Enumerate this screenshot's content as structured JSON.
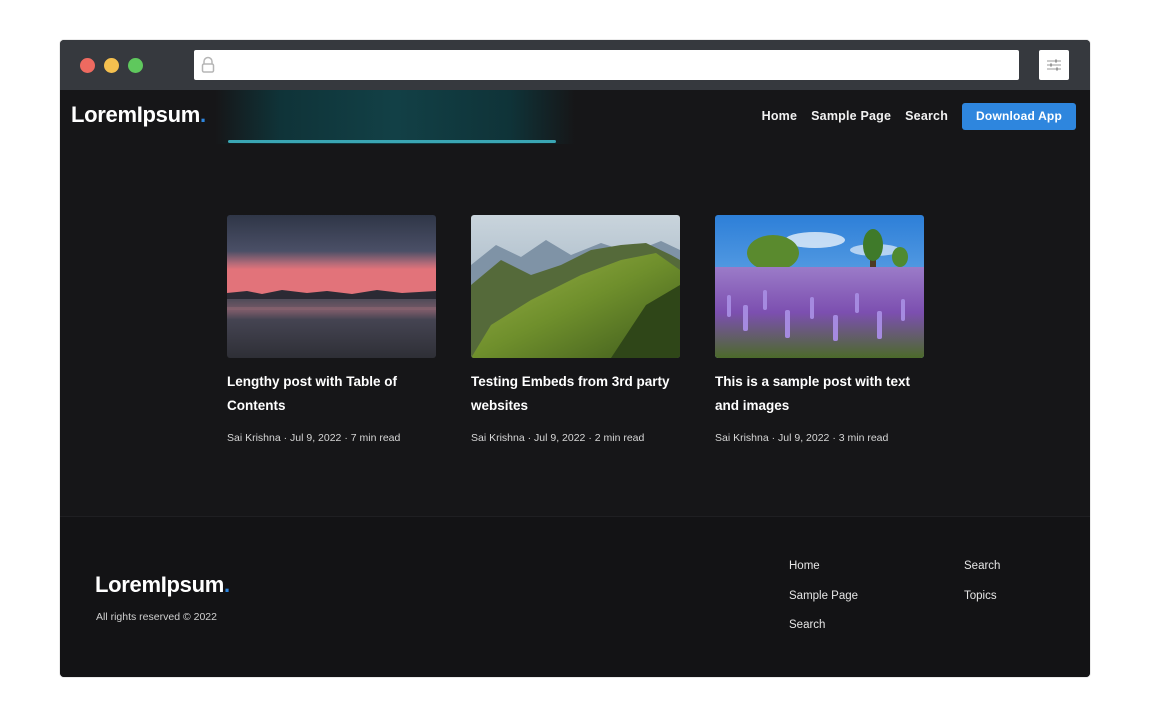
{
  "site": {
    "logo_text": "LoremIpsum",
    "logo_dot": "."
  },
  "nav": {
    "items": [
      "Home",
      "Sample Page",
      "Search"
    ],
    "cta_label": "Download App"
  },
  "posts": [
    {
      "title": "Lengthy post with Table of Contents",
      "meta": "Sai Krishna · Jul 9, 2022 · 7 min read"
    },
    {
      "title": "Testing Embeds from 3rd party websites",
      "meta": "Sai Krishna · Jul 9, 2022 · 2 min read"
    },
    {
      "title": "This is a sample post with text and images",
      "meta": "Sai Krishna · Jul 9, 2022 · 3 min read"
    }
  ],
  "footer": {
    "logo_text": "LoremIpsum",
    "logo_dot": ".",
    "copyright": "All rights reserved © 2022",
    "col1": [
      "Home",
      "Sample Page",
      "Search"
    ],
    "col2": [
      "Search",
      "Topics"
    ]
  },
  "icons": {
    "lock": "lock-icon",
    "settings": "sliders-icon"
  },
  "colors": {
    "accent": "#2e86de",
    "background": "#161618",
    "chrome": "#36393e"
  }
}
